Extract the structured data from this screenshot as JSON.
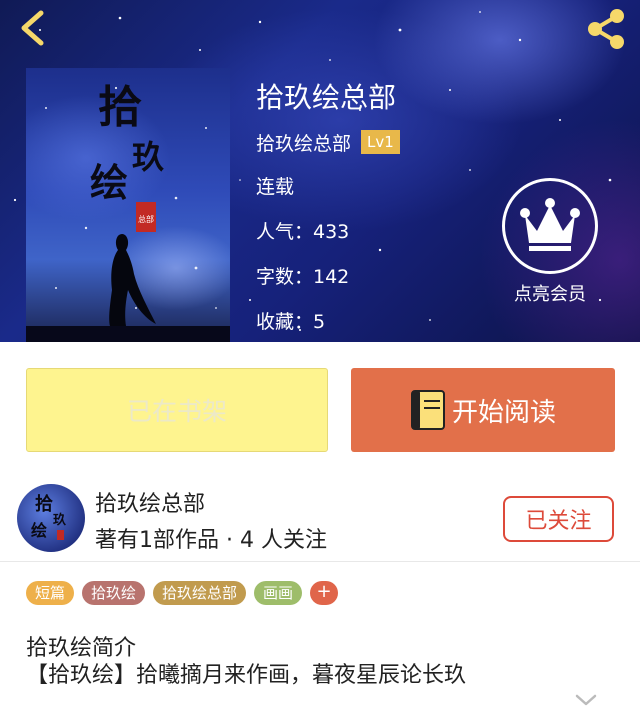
{
  "book": {
    "title": "拾玖绘总部",
    "author": "拾玖绘总部",
    "level_badge": "Lv1",
    "status": "连载",
    "popularity": "人气：433",
    "word_count": "字数：142",
    "favorites": "收藏：5",
    "cover_calligraphy": [
      "拾",
      "玖",
      "绘"
    ],
    "cover_seal": "总部"
  },
  "vip": {
    "label": "点亮会员"
  },
  "actions": {
    "shelf_label": "已在书架",
    "read_label": "开始阅读"
  },
  "author_card": {
    "name": "拾玖绘总部",
    "stats": "著有1部作品 · 4 人关注",
    "follow_label": "已关注",
    "avatar_text": [
      "拾",
      "玖",
      "绘"
    ]
  },
  "tags": {
    "items": [
      {
        "label": "短篇",
        "color": "#eeb04a"
      },
      {
        "label": "拾玖绘",
        "color": "#b8736e"
      },
      {
        "label": "拾玖绘总部",
        "color": "#c19b4e"
      },
      {
        "label": "画画",
        "color": "#9ebd6a"
      }
    ],
    "add_label": "+",
    "add_color": "#e0654a"
  },
  "intro": {
    "title": "拾玖绘简介",
    "text": "【拾玖绘】拾曦摘月来作画，暮夜星辰论长玖"
  },
  "colors": {
    "accent_orange": "#e2704a",
    "shelf_yellow": "#fef48f",
    "follow_red": "#dd4a3a",
    "badge_gold": "#e8b84a",
    "header_blue": "#16217a"
  },
  "icons": {
    "back": "chevron-left-icon",
    "share": "share-icon",
    "vip": "crown-icon",
    "book": "book-icon",
    "expand": "chevron-down-icon"
  }
}
